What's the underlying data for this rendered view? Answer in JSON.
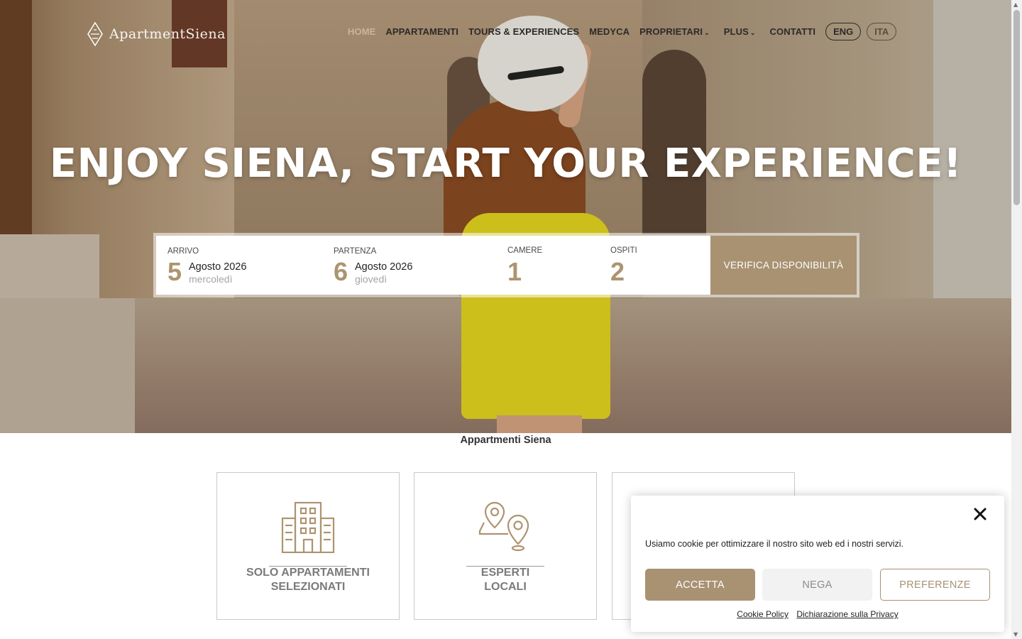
{
  "header": {
    "logo_text": "ApartmentSiena",
    "nav": [
      {
        "label": "HOME"
      },
      {
        "label": "APPARTAMENTI"
      },
      {
        "label": "TOURS & EXPERIENCES"
      },
      {
        "label": "MEDYCA"
      },
      {
        "label": "PROPRIETARI"
      },
      {
        "label": "PLUS"
      },
      {
        "label": "CONTATTI"
      }
    ],
    "chevron": "⌄",
    "languages": [
      "ENG",
      "ITA"
    ]
  },
  "hero": {
    "headline": "ENJOY SIENA, START YOUR EXPERIENCE!",
    "caption": "Appartmenti Siena"
  },
  "booking": {
    "arrival": {
      "label": "ARRIVO",
      "day": "5",
      "month": "Agosto 2026",
      "weekday": "mercoledì"
    },
    "departure": {
      "label": "PARTENZA",
      "day": "6",
      "month": "Agosto 2026",
      "weekday": "giovedì"
    },
    "rooms": {
      "label": "CAMERE",
      "value": "1"
    },
    "guests": {
      "label": "OSPITI",
      "value": "2"
    },
    "submit_label": "VERIFICA DISPONIBILITÀ"
  },
  "features": [
    {
      "line1": "SOLO APPARTAMENTI",
      "line2": "SELEZIONATI",
      "icon": "building-icon"
    },
    {
      "line1": "ESPERTI",
      "line2": "LOCALI",
      "icon": "map-pins-icon"
    },
    {
      "line1": "",
      "line2": "",
      "icon": ""
    }
  ],
  "cookie": {
    "message": "Usiamo cookie per ottimizzare il nostro sito web ed i nostri servizi.",
    "accept_label": "ACCETTA",
    "deny_label": "NEGA",
    "prefs_label": "PREFERENZE",
    "policy_link": "Cookie Policy",
    "privacy_link": "Dichiarazione sulla Privacy"
  },
  "colors": {
    "accent": "#a89272",
    "number": "#ad9470",
    "nav_text": "#2c2a28"
  }
}
